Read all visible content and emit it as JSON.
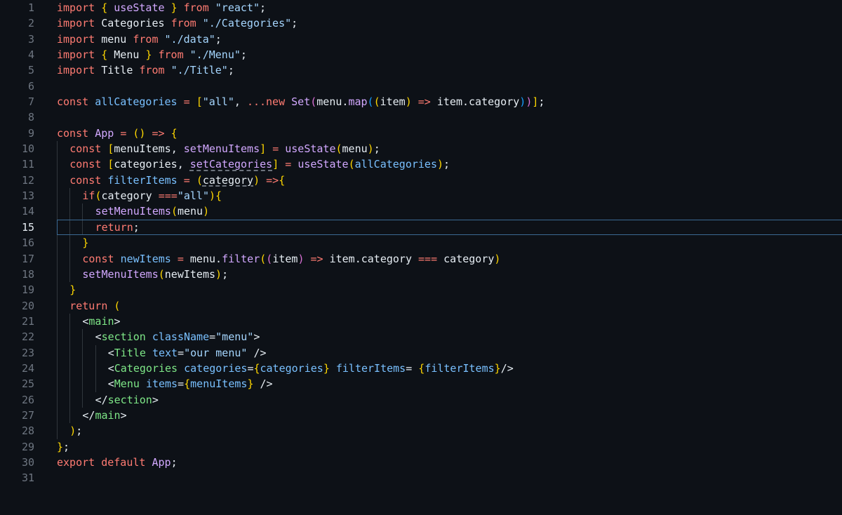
{
  "editor": {
    "current_line": 15,
    "lines": [
      {
        "n": "1",
        "text": "import { useState } from \"react\";"
      },
      {
        "n": "2",
        "text": "import Categories from \"./Categories\";"
      },
      {
        "n": "3",
        "text": "import menu from \"./data\";"
      },
      {
        "n": "4",
        "text": "import { Menu } from \"./Menu\";"
      },
      {
        "n": "5",
        "text": "import Title from \"./Title\";"
      },
      {
        "n": "6",
        "text": ""
      },
      {
        "n": "7",
        "text": "const allCategories = [\"all\", ...new Set(menu.map((item) => item.category))];"
      },
      {
        "n": "8",
        "text": ""
      },
      {
        "n": "9",
        "text": "const App = () => {"
      },
      {
        "n": "10",
        "text": "  const [menuItems, setMenuItems] = useState(menu);"
      },
      {
        "n": "11",
        "text": "  const [categories, setCategories] = useState(allCategories);"
      },
      {
        "n": "12",
        "text": "  const filterItems = (category) =>{"
      },
      {
        "n": "13",
        "text": "    if(category ===\"all\"){"
      },
      {
        "n": "14",
        "text": "      setMenuItems(menu)"
      },
      {
        "n": "15",
        "text": "      return;"
      },
      {
        "n": "16",
        "text": "    }"
      },
      {
        "n": "17",
        "text": "    const newItems = menu.filter((item) => item.category === category)"
      },
      {
        "n": "18",
        "text": "    setMenuItems(newItems);"
      },
      {
        "n": "19",
        "text": "  }"
      },
      {
        "n": "20",
        "text": "  return ("
      },
      {
        "n": "21",
        "text": "    <main>"
      },
      {
        "n": "22",
        "text": "      <section className=\"menu\">"
      },
      {
        "n": "23",
        "text": "        <Title text=\"our menu\" />"
      },
      {
        "n": "24",
        "text": "        <Categories categories={categories} filterItems= {filterItems}/>"
      },
      {
        "n": "25",
        "text": "        <Menu items={menuItems} />"
      },
      {
        "n": "26",
        "text": "      </section>"
      },
      {
        "n": "27",
        "text": "    </main>"
      },
      {
        "n": "28",
        "text": "  );"
      },
      {
        "n": "29",
        "text": "};"
      },
      {
        "n": "30",
        "text": "export default App;"
      },
      {
        "n": "31",
        "text": ""
      }
    ]
  },
  "colors": {
    "background": "#0d1117",
    "line_number": "#6e7681",
    "current_line_border": "#3b6a93",
    "keyword": "#ff7b72",
    "string": "#a5d6ff",
    "function": "#d2a8ff",
    "variable": "#79c0ff",
    "jsx_tag": "#7ee787"
  }
}
